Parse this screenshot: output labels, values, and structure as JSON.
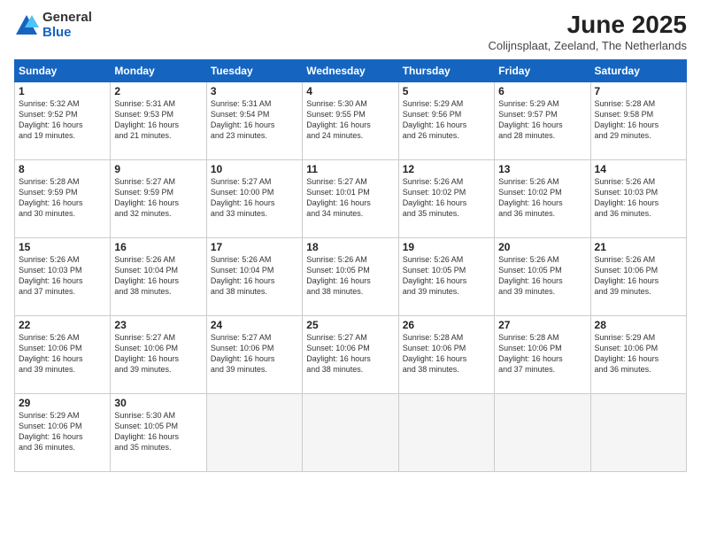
{
  "logo": {
    "general": "General",
    "blue": "Blue"
  },
  "title": "June 2025",
  "subtitle": "Colijnsplaat, Zeeland, The Netherlands",
  "headers": [
    "Sunday",
    "Monday",
    "Tuesday",
    "Wednesday",
    "Thursday",
    "Friday",
    "Saturday"
  ],
  "weeks": [
    [
      {
        "day": "1",
        "lines": [
          "Sunrise: 5:32 AM",
          "Sunset: 9:52 PM",
          "Daylight: 16 hours",
          "and 19 minutes."
        ]
      },
      {
        "day": "2",
        "lines": [
          "Sunrise: 5:31 AM",
          "Sunset: 9:53 PM",
          "Daylight: 16 hours",
          "and 21 minutes."
        ]
      },
      {
        "day": "3",
        "lines": [
          "Sunrise: 5:31 AM",
          "Sunset: 9:54 PM",
          "Daylight: 16 hours",
          "and 23 minutes."
        ]
      },
      {
        "day": "4",
        "lines": [
          "Sunrise: 5:30 AM",
          "Sunset: 9:55 PM",
          "Daylight: 16 hours",
          "and 24 minutes."
        ]
      },
      {
        "day": "5",
        "lines": [
          "Sunrise: 5:29 AM",
          "Sunset: 9:56 PM",
          "Daylight: 16 hours",
          "and 26 minutes."
        ]
      },
      {
        "day": "6",
        "lines": [
          "Sunrise: 5:29 AM",
          "Sunset: 9:57 PM",
          "Daylight: 16 hours",
          "and 28 minutes."
        ]
      },
      {
        "day": "7",
        "lines": [
          "Sunrise: 5:28 AM",
          "Sunset: 9:58 PM",
          "Daylight: 16 hours",
          "and 29 minutes."
        ]
      }
    ],
    [
      {
        "day": "8",
        "lines": [
          "Sunrise: 5:28 AM",
          "Sunset: 9:59 PM",
          "Daylight: 16 hours",
          "and 30 minutes."
        ]
      },
      {
        "day": "9",
        "lines": [
          "Sunrise: 5:27 AM",
          "Sunset: 9:59 PM",
          "Daylight: 16 hours",
          "and 32 minutes."
        ]
      },
      {
        "day": "10",
        "lines": [
          "Sunrise: 5:27 AM",
          "Sunset: 10:00 PM",
          "Daylight: 16 hours",
          "and 33 minutes."
        ]
      },
      {
        "day": "11",
        "lines": [
          "Sunrise: 5:27 AM",
          "Sunset: 10:01 PM",
          "Daylight: 16 hours",
          "and 34 minutes."
        ]
      },
      {
        "day": "12",
        "lines": [
          "Sunrise: 5:26 AM",
          "Sunset: 10:02 PM",
          "Daylight: 16 hours",
          "and 35 minutes."
        ]
      },
      {
        "day": "13",
        "lines": [
          "Sunrise: 5:26 AM",
          "Sunset: 10:02 PM",
          "Daylight: 16 hours",
          "and 36 minutes."
        ]
      },
      {
        "day": "14",
        "lines": [
          "Sunrise: 5:26 AM",
          "Sunset: 10:03 PM",
          "Daylight: 16 hours",
          "and 36 minutes."
        ]
      }
    ],
    [
      {
        "day": "15",
        "lines": [
          "Sunrise: 5:26 AM",
          "Sunset: 10:03 PM",
          "Daylight: 16 hours",
          "and 37 minutes."
        ]
      },
      {
        "day": "16",
        "lines": [
          "Sunrise: 5:26 AM",
          "Sunset: 10:04 PM",
          "Daylight: 16 hours",
          "and 38 minutes."
        ]
      },
      {
        "day": "17",
        "lines": [
          "Sunrise: 5:26 AM",
          "Sunset: 10:04 PM",
          "Daylight: 16 hours",
          "and 38 minutes."
        ]
      },
      {
        "day": "18",
        "lines": [
          "Sunrise: 5:26 AM",
          "Sunset: 10:05 PM",
          "Daylight: 16 hours",
          "and 38 minutes."
        ]
      },
      {
        "day": "19",
        "lines": [
          "Sunrise: 5:26 AM",
          "Sunset: 10:05 PM",
          "Daylight: 16 hours",
          "and 39 minutes."
        ]
      },
      {
        "day": "20",
        "lines": [
          "Sunrise: 5:26 AM",
          "Sunset: 10:05 PM",
          "Daylight: 16 hours",
          "and 39 minutes."
        ]
      },
      {
        "day": "21",
        "lines": [
          "Sunrise: 5:26 AM",
          "Sunset: 10:06 PM",
          "Daylight: 16 hours",
          "and 39 minutes."
        ]
      }
    ],
    [
      {
        "day": "22",
        "lines": [
          "Sunrise: 5:26 AM",
          "Sunset: 10:06 PM",
          "Daylight: 16 hours",
          "and 39 minutes."
        ]
      },
      {
        "day": "23",
        "lines": [
          "Sunrise: 5:27 AM",
          "Sunset: 10:06 PM",
          "Daylight: 16 hours",
          "and 39 minutes."
        ]
      },
      {
        "day": "24",
        "lines": [
          "Sunrise: 5:27 AM",
          "Sunset: 10:06 PM",
          "Daylight: 16 hours",
          "and 39 minutes."
        ]
      },
      {
        "day": "25",
        "lines": [
          "Sunrise: 5:27 AM",
          "Sunset: 10:06 PM",
          "Daylight: 16 hours",
          "and 38 minutes."
        ]
      },
      {
        "day": "26",
        "lines": [
          "Sunrise: 5:28 AM",
          "Sunset: 10:06 PM",
          "Daylight: 16 hours",
          "and 38 minutes."
        ]
      },
      {
        "day": "27",
        "lines": [
          "Sunrise: 5:28 AM",
          "Sunset: 10:06 PM",
          "Daylight: 16 hours",
          "and 37 minutes."
        ]
      },
      {
        "day": "28",
        "lines": [
          "Sunrise: 5:29 AM",
          "Sunset: 10:06 PM",
          "Daylight: 16 hours",
          "and 36 minutes."
        ]
      }
    ],
    [
      {
        "day": "29",
        "lines": [
          "Sunrise: 5:29 AM",
          "Sunset: 10:06 PM",
          "Daylight: 16 hours",
          "and 36 minutes."
        ]
      },
      {
        "day": "30",
        "lines": [
          "Sunrise: 5:30 AM",
          "Sunset: 10:05 PM",
          "Daylight: 16 hours",
          "and 35 minutes."
        ]
      },
      {
        "day": "",
        "lines": []
      },
      {
        "day": "",
        "lines": []
      },
      {
        "day": "",
        "lines": []
      },
      {
        "day": "",
        "lines": []
      },
      {
        "day": "",
        "lines": []
      }
    ]
  ]
}
